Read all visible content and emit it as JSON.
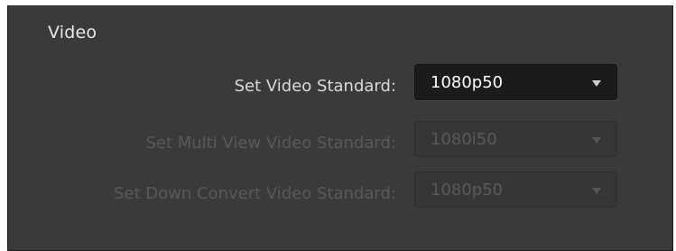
{
  "section": {
    "title": "Video"
  },
  "settings": [
    {
      "label": "Set Video Standard:",
      "value": "1080p50",
      "enabled": true,
      "icon": "chevron-down-icon"
    },
    {
      "label": "Set Multi View Video Standard:",
      "value": "1080i50",
      "enabled": false,
      "icon": "chevron-down-icon"
    },
    {
      "label": "Set Down Convert Video Standard:",
      "value": "1080p50",
      "enabled": false,
      "icon": "chevron-down-icon"
    }
  ],
  "colors": {
    "panel_bg": "#3a3a3a",
    "enabled_text": "#d9d9d9",
    "disabled_text": "#595959",
    "dropdown_enabled_bg": "#1b1b1b"
  }
}
